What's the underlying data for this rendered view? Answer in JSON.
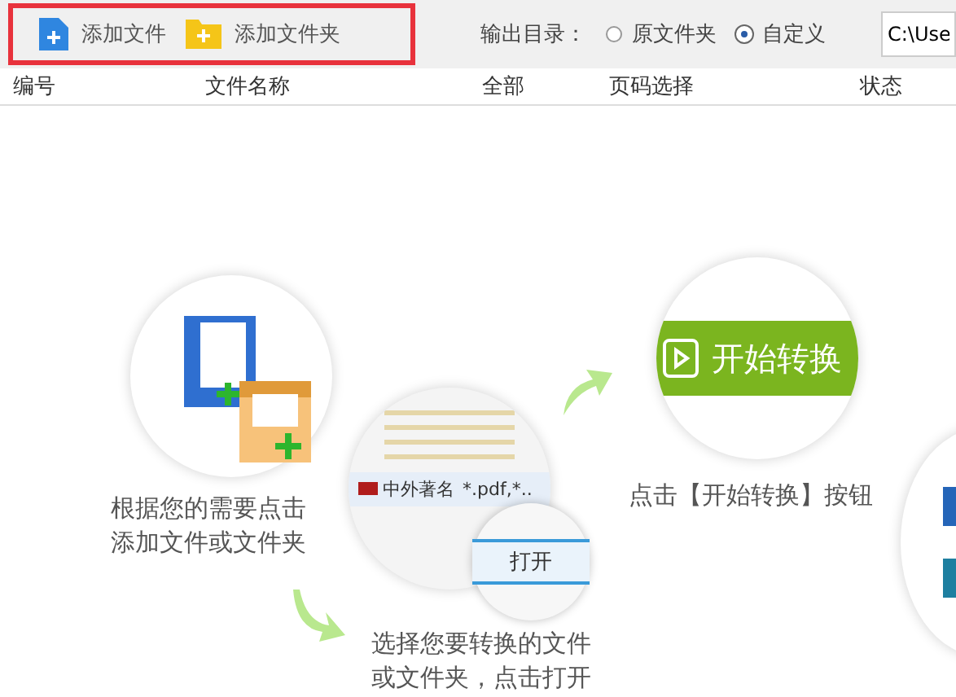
{
  "toolbar": {
    "buttons": [
      {
        "label": "添加文件",
        "kind": "file"
      },
      {
        "label": "添加文件夹",
        "kind": "folder"
      }
    ],
    "output_dir": {
      "label": "输出目录：",
      "options": [
        {
          "label": "原文件夹",
          "selected": false
        },
        {
          "label": "自定义",
          "selected": true
        }
      ],
      "path": "C:\\Use"
    }
  },
  "table": {
    "columns": [
      "编号",
      "文件名称",
      "全部",
      "页码选择",
      "状态"
    ]
  },
  "steps": [
    {
      "caption": "根据您的需要点击添加文件或文件夹"
    },
    {
      "caption": "选择您要转换的文件或文件夹，点击打开",
      "file_name": "中外著名",
      "filter": "*.pdf,*..",
      "open_button": "打开"
    },
    {
      "caption": "点击【开始转换】按钮",
      "start_button": "开始转换"
    }
  ]
}
